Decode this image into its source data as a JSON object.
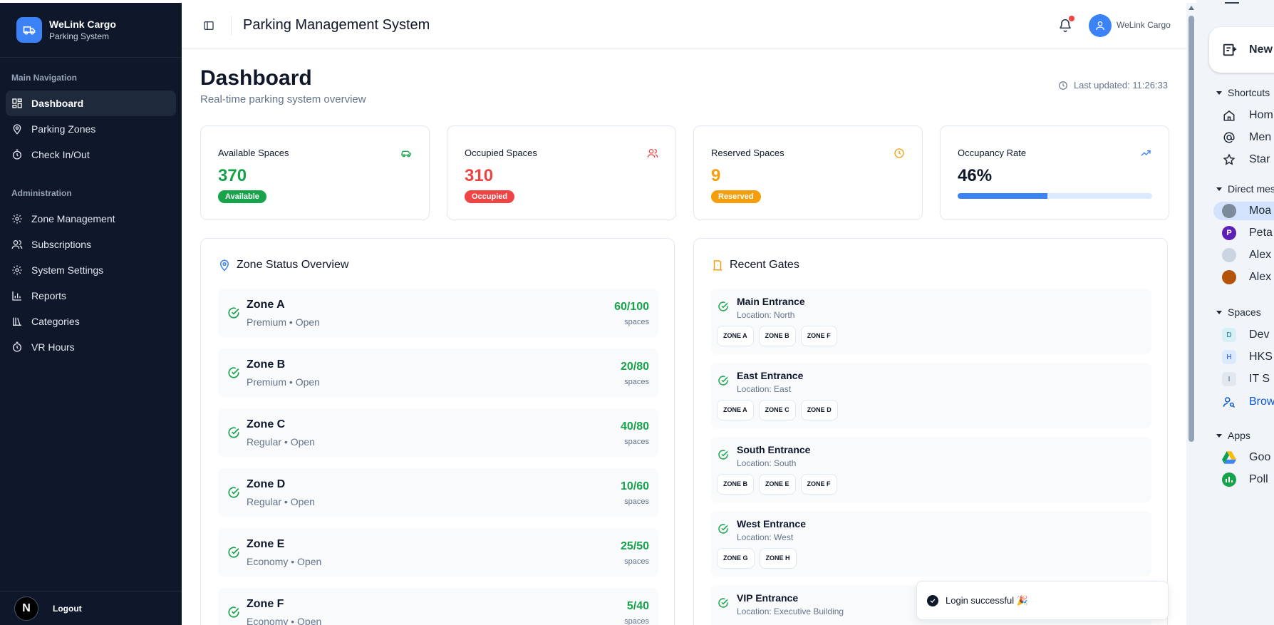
{
  "brand": {
    "name": "WeLink Cargo",
    "subtitle": "Parking System"
  },
  "sidebar": {
    "main_section": "Main Navigation",
    "main_items": [
      {
        "label": "Dashboard",
        "icon": "dashboard-icon",
        "active": true
      },
      {
        "label": "Parking Zones",
        "icon": "map-pin-icon"
      },
      {
        "label": "Check In/Out",
        "icon": "timer-icon"
      }
    ],
    "admin_section": "Administration",
    "admin_items": [
      {
        "label": "Zone Management",
        "icon": "gear-icon"
      },
      {
        "label": "Subscriptions",
        "icon": "users-icon"
      },
      {
        "label": "System Settings",
        "icon": "gear-icon"
      },
      {
        "label": "Reports",
        "icon": "bar-chart-icon"
      },
      {
        "label": "Categories",
        "icon": "library-icon"
      },
      {
        "label": "VR Hours",
        "icon": "timer-icon"
      }
    ],
    "footer": {
      "avatar_letter": "N",
      "logout_label": "Logout"
    }
  },
  "topbar": {
    "title": "Parking Management System",
    "user_name": "WeLink Cargo"
  },
  "page": {
    "title": "Dashboard",
    "subtitle": "Real-time parking system overview",
    "last_updated": "Last updated: 11:26:33"
  },
  "stats": {
    "available": {
      "label": "Available Spaces",
      "value": "370",
      "badge": "Available",
      "color": "#16a34a",
      "icon": "car-icon"
    },
    "occupied": {
      "label": "Occupied Spaces",
      "value": "310",
      "badge": "Occupied",
      "color": "#ef4444",
      "icon": "users-icon"
    },
    "reserved": {
      "label": "Reserved Spaces",
      "value": "9",
      "badge": "Reserved",
      "color": "#f59e0b",
      "icon": "clock-icon"
    },
    "occupancy": {
      "label": "Occupancy Rate",
      "value": "46%",
      "progress": 0.46,
      "color": "#3b82f6",
      "icon": "trending-up-icon"
    }
  },
  "zones_panel": {
    "title": "Zone Status Overview",
    "unit": "spaces",
    "zones": [
      {
        "name": "Zone A",
        "meta": "Premium • Open",
        "count": "60/100"
      },
      {
        "name": "Zone B",
        "meta": "Premium • Open",
        "count": "20/80"
      },
      {
        "name": "Zone C",
        "meta": "Regular • Open",
        "count": "40/80"
      },
      {
        "name": "Zone D",
        "meta": "Regular • Open",
        "count": "10/60"
      },
      {
        "name": "Zone E",
        "meta": "Economy • Open",
        "count": "25/50"
      },
      {
        "name": "Zone F",
        "meta": "Economy • Open",
        "count": "5/40"
      }
    ]
  },
  "gates_panel": {
    "title": "Recent Gates",
    "gates": [
      {
        "name": "Main Entrance",
        "location": "Location: North",
        "zones": [
          "ZONE A",
          "ZONE B",
          "ZONE F"
        ]
      },
      {
        "name": "East Entrance",
        "location": "Location: East",
        "zones": [
          "ZONE A",
          "ZONE C",
          "ZONE D"
        ]
      },
      {
        "name": "South Entrance",
        "location": "Location: South",
        "zones": [
          "ZONE B",
          "ZONE E",
          "ZONE F"
        ]
      },
      {
        "name": "West Entrance",
        "location": "Location: West",
        "zones": [
          "ZONE G",
          "ZONE H"
        ]
      },
      {
        "name": "VIP Entrance",
        "location": "Location: Executive Building",
        "zones": []
      }
    ]
  },
  "toast": {
    "message": "Login successful 🎉"
  },
  "right_panel": {
    "new_label": "New",
    "shortcuts_label": "Shortcuts",
    "shortcuts": [
      {
        "label": "Hom",
        "icon": "home-icon"
      },
      {
        "label": "Men",
        "icon": "at-sign-icon"
      },
      {
        "label": "Star",
        "icon": "star-icon"
      }
    ],
    "dm_label": "Direct mes",
    "dms": [
      {
        "label": "Moa",
        "avatar_color": "#7c8a9a",
        "highlight": true
      },
      {
        "label": "Peta",
        "avatar_color": "#5b21b6",
        "avatar_letter": "P"
      },
      {
        "label": "Alex",
        "avatar_color": "#cbd5e1"
      },
      {
        "label": "Alex",
        "avatar_color": "#b45309"
      }
    ],
    "spaces_label": "Spaces",
    "spaces": [
      {
        "label": "Dev",
        "letter": "D",
        "bg": "#d6f0f5",
        "fg": "#0e7490"
      },
      {
        "label": "HKS",
        "letter": "H",
        "bg": "#dbeafe",
        "fg": "#1d4ed8"
      },
      {
        "label": "IT S",
        "letter": "I",
        "bg": "#e2e8f0",
        "fg": "#475569"
      }
    ],
    "browse_label": "Brow",
    "apps_label": "Apps",
    "apps": [
      {
        "label": "Goo",
        "icon": "google-drive-icon"
      },
      {
        "label": "Poll",
        "icon": "poll-icon"
      }
    ]
  }
}
